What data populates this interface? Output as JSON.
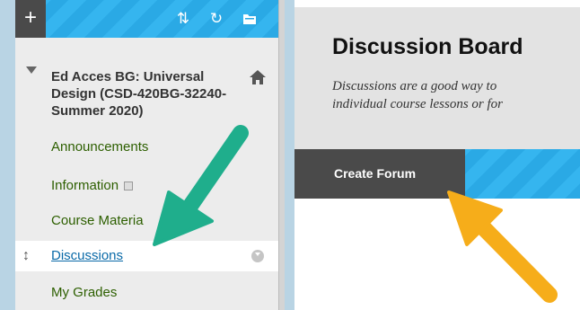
{
  "toolbar": {
    "add_icon": "+",
    "sort_icon": "⇅",
    "refresh_icon": "↻",
    "folder_icon": "folder-icon"
  },
  "course": {
    "title": "Ed Acces BG: Universal Design (CSD-420BG-32240-Summer 2020)"
  },
  "menu": {
    "announcements": "Announcements",
    "information": "Information",
    "course_materials": "Course Materia",
    "discussions": "Discussions",
    "my_grades": "My Grades"
  },
  "main": {
    "title": "Discussion Board",
    "description_line1": "Discussions are a good way to",
    "description_line2": "individual course lessons or for",
    "create_forum": "Create Forum"
  },
  "colors": {
    "brand_blue": "#2aa9e5",
    "dark_button": "#4a4a4a",
    "menu_green": "#2d5f00",
    "link_blue": "#0a6aa8",
    "arrow_teal": "#1fae8c",
    "arrow_orange": "#f6ad1a"
  }
}
